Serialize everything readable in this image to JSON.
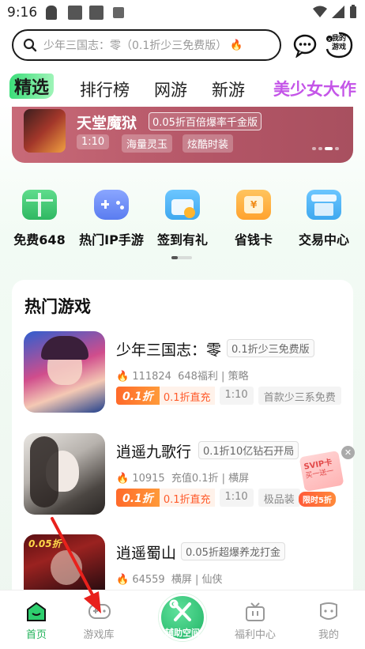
{
  "status_bar": {
    "time": "9:16"
  },
  "search": {
    "placeholder": "少年三国志：零（0.1折少三免费版）"
  },
  "header": {
    "my_games_label": "我的\n游戏"
  },
  "tabs": [
    {
      "label": "精选",
      "active": true
    },
    {
      "label": "排行榜"
    },
    {
      "label": "网游"
    },
    {
      "label": "新游"
    },
    {
      "label": "美少女大作"
    }
  ],
  "banner": {
    "title": "天堂魔狱",
    "badge": "0.05折百倍爆率千金版",
    "tags": [
      "1:10",
      "海量灵玉",
      "炫酷时装"
    ]
  },
  "quick_entries": [
    {
      "label": "免费648",
      "icon": "gift-icon",
      "color": "#36c86a"
    },
    {
      "label": "热门IP手游",
      "icon": "gamepad-icon",
      "color": "#5a7cf0"
    },
    {
      "label": "签到有礼",
      "icon": "calendar-icon",
      "color": "#3ea8ef"
    },
    {
      "label": "省钱卡",
      "icon": "card-icon",
      "color": "#ffa22e"
    },
    {
      "label": "交易中心",
      "icon": "shop-icon",
      "color": "#3ea8ef"
    }
  ],
  "hot_games": {
    "title": "热门游戏",
    "items": [
      {
        "name": "少年三国志：零",
        "badge": "0.1折少三免费版",
        "downloads": "111824",
        "meta": "648福利 | 策略",
        "discount": "0.1折",
        "discount_text": "0.1折直充",
        "ratio": "1:10",
        "extra": "首款少三系免费"
      },
      {
        "name": "逍遥九歌行",
        "badge": "0.1折10亿钻石开局",
        "downloads": "10915",
        "meta": "充值0.1折 | 横屏",
        "discount": "0.1折",
        "discount_text": "0.1折直充",
        "ratio": "1:10",
        "extra": "极品装"
      },
      {
        "name": "逍遥蜀山",
        "badge": "0.05折超爆养龙打金",
        "downloads": "64559",
        "meta": "横屏 | 仙侠",
        "thumb_label": "0.05折"
      }
    ]
  },
  "float_promo": {
    "line1": "SVIP卡",
    "line2": "买一送一",
    "line3": "限时5折"
  },
  "bottom_nav": [
    {
      "label": "首页",
      "active": true
    },
    {
      "label": "游戏库"
    },
    {
      "label": "辅助空间"
    },
    {
      "label": "福利中心"
    },
    {
      "label": "我的"
    }
  ],
  "colors": {
    "accent": "#22b35a",
    "discount": "#ff6a2a",
    "annotation_arrow": "#e8211c"
  }
}
